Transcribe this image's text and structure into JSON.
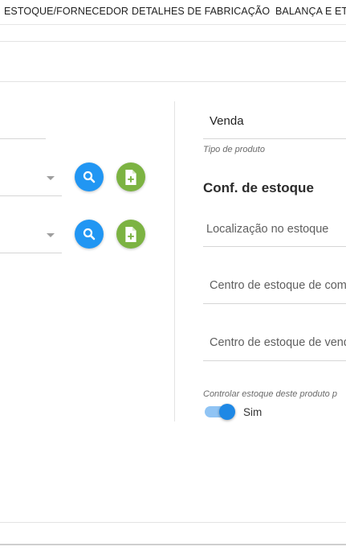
{
  "tabs": [
    {
      "label": "ESTOQUE/FORNECEDOR"
    },
    {
      "label": "DETALHES DE FABRICAÇÃO"
    },
    {
      "label": "BALANÇA E ET"
    }
  ],
  "product_type": {
    "value": "Venda",
    "hint": "Tipo de produto"
  },
  "stock_config": {
    "title": "Conf. de estoque",
    "location_placeholder": "Localização no estoque",
    "purchase_center_placeholder": "Centro de estoque de com",
    "sales_center_placeholder": "Centro de estoque de vend",
    "control_label": "Controlar estoque deste produto p",
    "control_toggle": {
      "on": true,
      "label": "Sim"
    }
  },
  "icons": {
    "search": "search-icon",
    "add_file": "file-add-icon"
  },
  "colors": {
    "search_button": "#2196f3",
    "add_button": "#7cb342",
    "toggle_thumb": "#1e88e5",
    "toggle_track": "#90c4f4"
  }
}
